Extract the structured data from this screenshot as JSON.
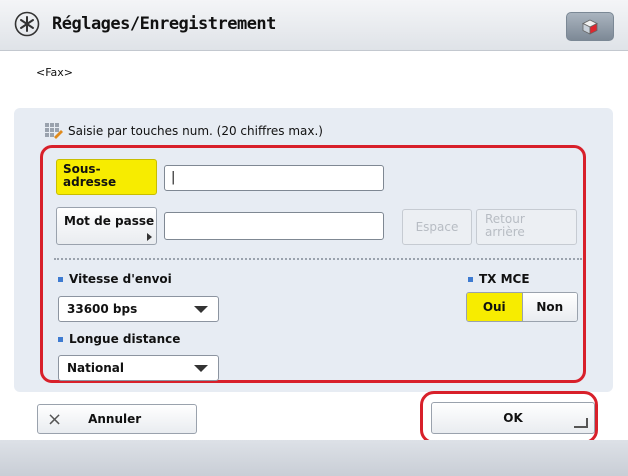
{
  "header": {
    "title": "Réglages/Enregistrement",
    "corner_icon": "cube-icon"
  },
  "subtitle": "<Fax>",
  "hint": {
    "icon": "keypad-icon",
    "text": "Saisie par touches num. (20 chiffres max.)"
  },
  "subaddress": {
    "label": "Sous-\nadresse",
    "value": "|"
  },
  "password": {
    "label": "Mot de passe",
    "value": ""
  },
  "space_label": "Espace",
  "backspace_label": "Retour\narrière",
  "speed": {
    "label": "Vitesse d'envoi",
    "value": "33600 bps"
  },
  "ecm": {
    "label": "TX MCE",
    "on": "Oui",
    "off": "Non"
  },
  "distance": {
    "label": "Longue distance",
    "value": "National"
  },
  "cancel_label": "Annuler",
  "ok_label": "OK",
  "colors": {
    "accent": "#f7ec00",
    "highlight": "#d8202a",
    "bullet": "#3e7bd1"
  }
}
